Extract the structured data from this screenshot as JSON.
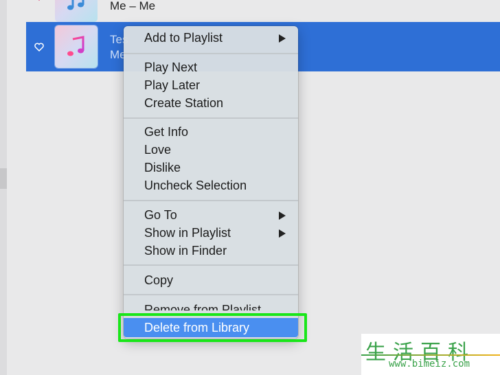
{
  "rows": {
    "previous": {
      "title": "Me – Me"
    },
    "selected": {
      "title": "Tes",
      "artist": "Me"
    }
  },
  "context_menu": {
    "items": [
      {
        "label": "Add to Playlist",
        "submenu": true
      },
      {
        "label": "Play Next"
      },
      {
        "label": "Play Later"
      },
      {
        "label": "Create Station"
      },
      {
        "label": "Get Info"
      },
      {
        "label": "Love"
      },
      {
        "label": "Dislike"
      },
      {
        "label": "Uncheck Selection"
      },
      {
        "label": "Go To",
        "submenu": true
      },
      {
        "label": "Show in Playlist",
        "submenu": true
      },
      {
        "label": "Show in Finder"
      },
      {
        "label": "Copy"
      },
      {
        "label": "Remove from Playlist"
      },
      {
        "label": "Delete from Library",
        "highlighted": true
      }
    ]
  },
  "watermark": {
    "chars": "生活百科",
    "url": "www.bimeiz.com"
  },
  "colors": {
    "selection": "#2e6fd6",
    "menu_highlight": "#4a8ff0",
    "annotation_box": "#19e619",
    "heart": "#e0245e"
  }
}
